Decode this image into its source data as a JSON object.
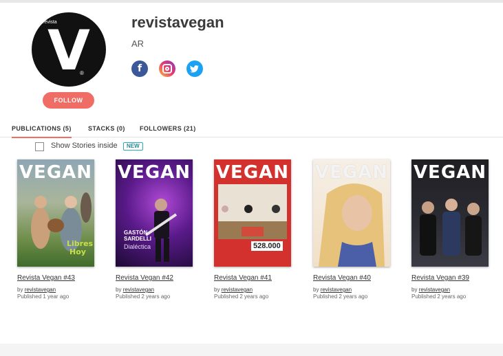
{
  "profile": {
    "logo_small_text": "revista",
    "logo_letter": "V",
    "logo_mark": "®",
    "username": "revistavegan",
    "country": "AR",
    "follow_label": "FOLLOW",
    "social": [
      {
        "icon": "facebook-icon",
        "glyph": "f"
      },
      {
        "icon": "instagram-icon",
        "glyph": ""
      },
      {
        "icon": "twitter-icon",
        "glyph": ""
      }
    ]
  },
  "tabs": [
    {
      "label": "PUBLICATIONS (5)",
      "active": true
    },
    {
      "label": "STACKS (0)",
      "active": false
    },
    {
      "label": "FOLLOWERS (21)",
      "active": false
    }
  ],
  "filter": {
    "label": "Show Stories inside",
    "checked": false,
    "badge": "NEW"
  },
  "publications": [
    {
      "title": "Revista Vegan #43",
      "by": "by",
      "author": "revistavegan",
      "published": "Published 1 year ago",
      "masthead": "VEGAN"
    },
    {
      "title": "Revista Vegan #42",
      "by": "by",
      "author": "revistavegan",
      "published": "Published 2 years ago",
      "masthead": "VEGAN",
      "cover_text": "GASTÓN SARDELLI",
      "cover_sub": "Dialéctica"
    },
    {
      "title": "Revista Vegan #41",
      "by": "by",
      "author": "revistavegan",
      "published": "Published 2 years ago",
      "masthead": "VEGAN",
      "cover_text": "528.000"
    },
    {
      "title": "Revista Vegan #40",
      "by": "by",
      "author": "revistavegan",
      "published": "Published 2 years ago",
      "masthead": "VEGAN"
    },
    {
      "title": "Revista Vegan #39",
      "by": "by",
      "author": "revistavegan",
      "published": "Published 2 years ago",
      "masthead": "VEGAN"
    }
  ],
  "colors": {
    "accent": "#ef6d64",
    "badge": "#2aa7b8",
    "facebook": "#3b5998",
    "twitter": "#1da1f2"
  }
}
